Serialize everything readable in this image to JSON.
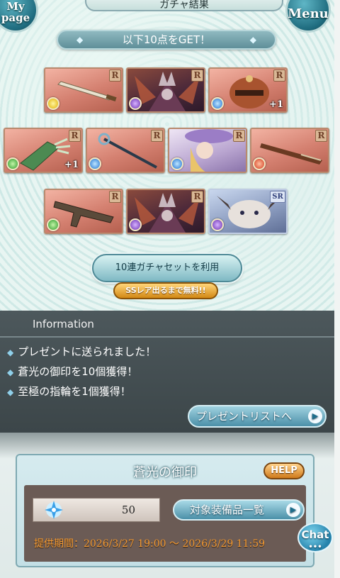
{
  "header": {
    "title": "ガチャ結果",
    "mypage_label": "My\npage",
    "menu_label": "Menu"
  },
  "get_banner": "以下10点をGET！",
  "items": [
    {
      "name": "weapon-sword",
      "rarity": "R",
      "element": "light",
      "plus": ""
    },
    {
      "name": "summon-dark",
      "rarity": "R",
      "element": "dark",
      "plus": ""
    },
    {
      "name": "summon-water",
      "rarity": "R",
      "element": "water",
      "plus": "+1"
    },
    {
      "name": "weapon-gauntlet",
      "rarity": "R",
      "element": "wind",
      "plus": "+1"
    },
    {
      "name": "weapon-staff",
      "rarity": "R",
      "element": "water",
      "plus": ""
    },
    {
      "name": "summon-sage",
      "rarity": "R",
      "element": "water",
      "plus": ""
    },
    {
      "name": "weapon-rifle",
      "rarity": "R",
      "element": "fire",
      "plus": ""
    },
    {
      "name": "weapon-gun",
      "rarity": "R",
      "element": "wind",
      "plus": ""
    },
    {
      "name": "summon-dark-2",
      "rarity": "R",
      "element": "dark",
      "plus": ""
    },
    {
      "name": "summon-sr-dragon",
      "rarity": "SR",
      "element": "dark",
      "plus": ""
    }
  ],
  "gacha_button": "10連ガチャセットを利用",
  "free_badge": "SSレア出るまで無料!!",
  "information": {
    "heading": "Information",
    "lines": [
      "プレゼントに送られました！",
      "蒼光の御印を10個獲得！",
      "至極の指輪を1個獲得！"
    ],
    "present_button": "プレゼントリストへ"
  },
  "sigil_panel": {
    "title": "蒼光の御印",
    "help_label": "HELP",
    "count": "50",
    "equip_button": "対象装備品一覧",
    "period": "提供期間：2026/3/27 19:00 ～ 2026/3/29 11:59"
  },
  "chat_label": "Chat",
  "icons": {
    "arrow": "circle-arrow-right-icon",
    "bullet": "diamond-bullet-icon",
    "sigil": "blue-star-sigil-icon"
  }
}
